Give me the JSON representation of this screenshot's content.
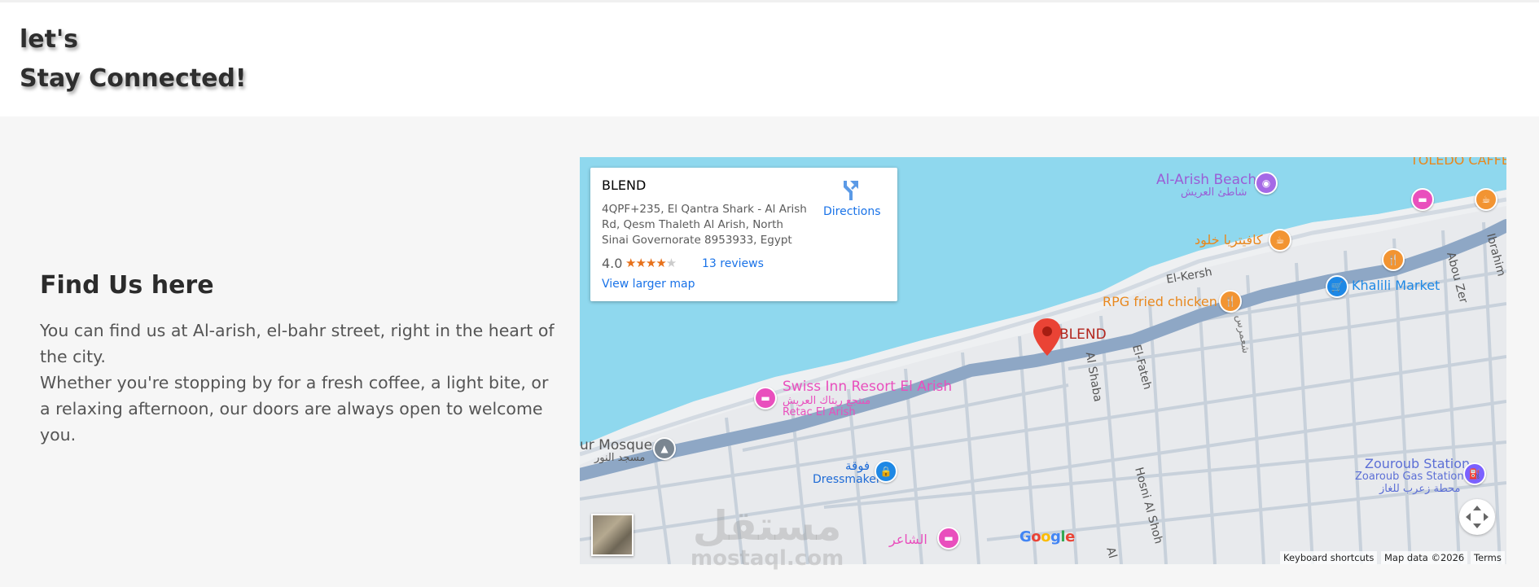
{
  "hero": {
    "line1": "let's",
    "line2": "Stay Connected!"
  },
  "find_us": {
    "title": "Find Us here",
    "paragraph1": "You can find us at Al-arish, el-bahr street, right in the heart of the city.",
    "paragraph2": "Whether you're stopping by for a fresh coffee, a light bite, or a relaxing afternoon, our doors are always open to welcome you."
  },
  "map": {
    "card": {
      "place_name": "BLEND",
      "address": "4QPF+235, El Qantra Shark - Al Arish Rd, Qesm Thaleth Al Arish, North Sinai Governorate 8953933, Egypt",
      "rating": "4.0",
      "stars_filled": 4,
      "stars_total": 5,
      "reviews_link": "13 reviews",
      "larger_map_link": "View larger map",
      "directions_label": "Directions"
    },
    "labels": {
      "beach_en": "Al-Arish Beach",
      "beach_ar": "شاطئ العريش",
      "toledo": "TOLEDO CAFFE",
      "cafeteria": "كافيتريا خلود",
      "el_kersh": "El-Kersh",
      "khalili": "Khalili Market",
      "abou_zer": "Abou Zer",
      "ibrahim": "Ibrahim",
      "rpg": "RPG fried chicken",
      "arabic_street": "شعمرس",
      "blend": "BLEND",
      "el_fateh": "El-Fateh",
      "al_shaba": "Al Shaba",
      "swiss_en": "Swiss Inn Resort El Arish",
      "swiss_ar": "منتجع ريتاك العريش",
      "retac": "Retac El Arish",
      "mosque_en": "ur Mosque",
      "mosque_ar": "مسجد النور",
      "dressmaker_ar": "فوقة",
      "dressmaker_en": "Dressmaker",
      "zouroub_en": "Zouroub Station",
      "zouroub_sub": "Zoaroub Gas Station",
      "zouroub_ar": "محطة زعرب للغاز",
      "hosni": "Hosni Al Shoh",
      "al_bottom": "Al",
      "shaer": "الشاعر"
    },
    "google_logo": "Google",
    "attribution": {
      "shortcuts": "Keyboard shortcuts",
      "map_data": "Map data ©2026",
      "terms": "Terms"
    },
    "colors": {
      "water": "#8fd8ee",
      "land": "#e8eaed",
      "main_road": "#8ea7c5",
      "street": "#c5cfd9",
      "link": "#1a73e8",
      "pin_red": "#ea4335",
      "hotel_pink": "#e94fbd",
      "food_orange": "#f29432",
      "shop_blue": "#1e88e5",
      "gas_purple": "#7b61ff"
    },
    "icons": [
      "directions-icon",
      "thumbnail-satellite-icon",
      "recenter-icon",
      "location-pin-icon"
    ]
  },
  "watermark": {
    "arabic": "مستقل",
    "latin": "mostaql.com"
  }
}
